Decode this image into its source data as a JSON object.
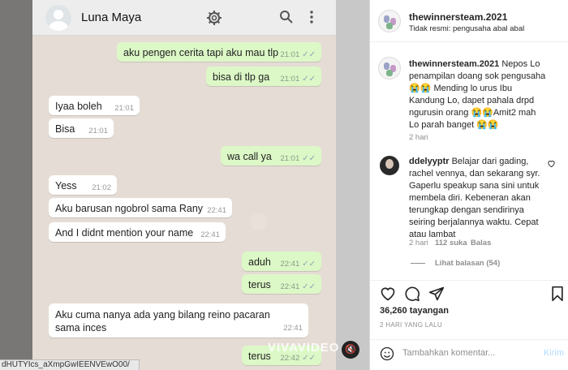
{
  "chat": {
    "contact_name": "Luna Maya",
    "icons": [
      "settings-gear-icon",
      "search-icon",
      "more-vertical-icon",
      "double-check-icon",
      "mute-icon"
    ],
    "messages": [
      {
        "dir": "out",
        "text": "aku pengen cerita tapi aku mau tlp",
        "time": "21:01"
      },
      {
        "dir": "out",
        "text": "bisa di tlp ga",
        "time": "21:01"
      },
      {
        "dir": "in",
        "text": "Iyaa boleh",
        "time": "21:01"
      },
      {
        "dir": "in",
        "text": "Bisa",
        "time": "21:01"
      },
      {
        "dir": "out",
        "text": "wa call ya",
        "time": "21:01"
      },
      {
        "dir": "in",
        "text": "Yess",
        "time": "21:02"
      },
      {
        "dir": "in",
        "text": "Aku barusan ngobrol sama Rany",
        "time": "22:41"
      },
      {
        "dir": "in",
        "text": "And I didnt mention your name",
        "time": "22:41"
      },
      {
        "dir": "out",
        "text": "aduh",
        "time": "22:41"
      },
      {
        "dir": "out",
        "text": "terus",
        "time": "22:41"
      },
      {
        "dir": "in",
        "text": "Aku cuma nanya ada yang bilang reino pacaran sama inces",
        "time": "22:41"
      },
      {
        "dir": "out",
        "text": "terus",
        "time": "22:42"
      }
    ],
    "watermark": "VIVAVIDEO",
    "url_text": "dHUTYIcs_aXmpGwIEENVEwO00/"
  },
  "instagram": {
    "header": {
      "username": "thewinnersteam.2021",
      "subtitle": "Tidak resmi: pengusaha abal abal",
      "more_label": "•••"
    },
    "caption": {
      "username": "thewinnersteam.2021",
      "text": "Nepos Lo penampilan doang sok pengusaha 😭😭 Mending lo urus Ibu Kandung Lo, dapet pahala drpd ngurusin orang 😭😭Amit2 mah Lo parah banget 😭😭",
      "time": "2 hari"
    },
    "comment": {
      "username": "ddelyyptr",
      "text": "Belajar dari gading, rachel vennya, dan sekarang syr. Gaperlu speakup sana sini untuk membela diri. Kebeneran akan terungkap dengan sendirinya seiring berjalannya waktu. Cepat atau lambat",
      "time": "2 hari",
      "likes": "112 suka",
      "reply": "Balas",
      "view_replies": "Lihat balasan (54)"
    },
    "actions": {
      "icons": [
        "heart-icon",
        "comment-icon",
        "share-icon",
        "bookmark-icon"
      ],
      "views": "36,260 tayangan",
      "date": "2 HARI YANG LALU"
    },
    "add_comment": {
      "placeholder": "Tambahkan komentar...",
      "post_label": "Kirim"
    }
  }
}
